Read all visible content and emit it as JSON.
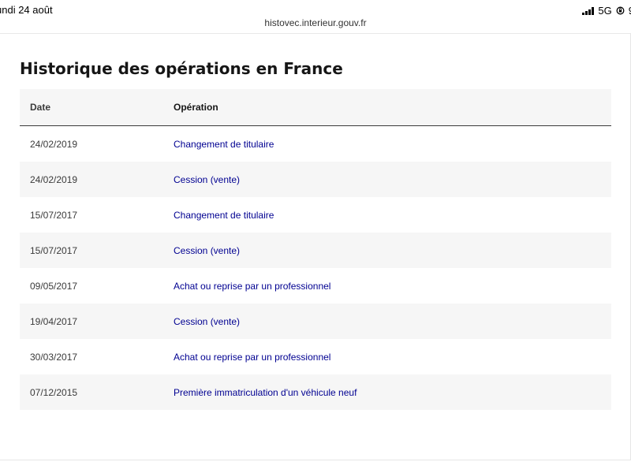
{
  "statusbar": {
    "date": "undi 24 août",
    "network": "5G",
    "battery_partial": "9"
  },
  "browser": {
    "url": "histovec.interieur.gouv.fr"
  },
  "page": {
    "title": "Historique des opérations en France"
  },
  "table": {
    "headers": {
      "date": "Date",
      "operation": "Opération"
    },
    "rows": [
      {
        "date": "24/02/2019",
        "operation": "Changement de titulaire"
      },
      {
        "date": "24/02/2019",
        "operation": "Cession (vente)"
      },
      {
        "date": "15/07/2017",
        "operation": "Changement de titulaire"
      },
      {
        "date": "15/07/2017",
        "operation": "Cession (vente)"
      },
      {
        "date": "09/05/2017",
        "operation": "Achat ou reprise par un professionnel"
      },
      {
        "date": "19/04/2017",
        "operation": "Cession (vente)"
      },
      {
        "date": "30/03/2017",
        "operation": "Achat ou reprise par un professionnel"
      },
      {
        "date": "07/12/2015",
        "operation": "Première immatriculation d'un véhicule neuf"
      }
    ]
  },
  "colors": {
    "link": "#000091",
    "text": "#161616",
    "row_alt": "#f6f6f6"
  }
}
